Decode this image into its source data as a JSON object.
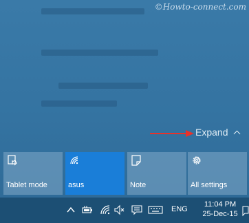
{
  "watermark": "©Howto-connect.com",
  "expand": {
    "label": "Expand"
  },
  "tiles": [
    {
      "label": "Tablet mode",
      "icon": "tablet-mode-icon",
      "active": false
    },
    {
      "label": "asus",
      "icon": "wifi-icon",
      "active": true
    },
    {
      "label": "Note",
      "icon": "note-icon",
      "active": false
    },
    {
      "label": "All settings",
      "icon": "settings-gear-icon",
      "active": false
    }
  ],
  "taskbar": {
    "language": "ENG",
    "time": "11:04 PM",
    "date": "25-Dec-15",
    "icons": [
      "chevron-up-icon",
      "battery-icon",
      "wifi-icon",
      "volume-muted-icon",
      "action-center-icon",
      "keyboard-icon"
    ]
  },
  "colors": {
    "panel": "#3473a1",
    "tile": "#82aac8",
    "tile_active": "#1a7ed8",
    "taskbar": "#1c4f74",
    "arrow": "#e8322a"
  }
}
